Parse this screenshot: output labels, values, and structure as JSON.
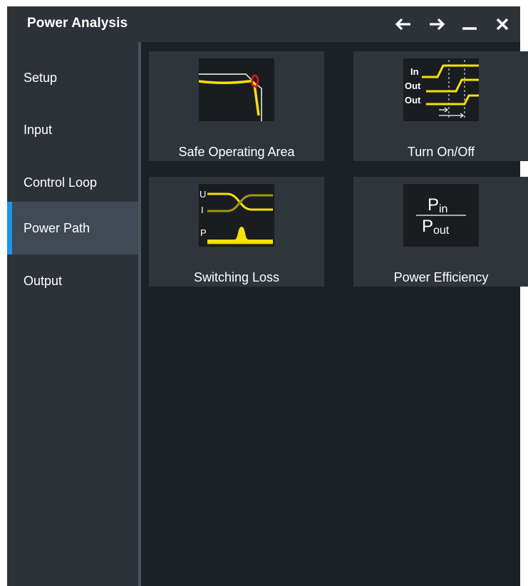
{
  "window": {
    "title": "Power Analysis",
    "controls": {
      "back_icon": "arrow-left",
      "forward_icon": "arrow-right",
      "minimize_icon": "minimize",
      "close_icon": "close"
    }
  },
  "sidebar": {
    "items": [
      {
        "label": "Setup",
        "active": false
      },
      {
        "label": "Input",
        "active": false
      },
      {
        "label": "Control Loop",
        "active": false
      },
      {
        "label": "Power Path",
        "active": true
      },
      {
        "label": "Output",
        "active": false
      }
    ]
  },
  "tiles": [
    {
      "label": "Safe Operating Area",
      "icon": "safe-operating-area-icon"
    },
    {
      "label": "Turn On/Off",
      "icon": "turn-on-off-icon",
      "icon_text": {
        "in": "In",
        "out1": "Out",
        "out2": "Out"
      }
    },
    {
      "label": "Switching Loss",
      "icon": "switching-loss-icon",
      "icon_text": {
        "u": "U",
        "i": "I",
        "p": "P"
      }
    },
    {
      "label": "Power Efficiency",
      "icon": "power-efficiency-icon",
      "icon_text": {
        "p_top": "P",
        "sub_top": "in",
        "p_bottom": "P",
        "sub_bottom": "out"
      }
    }
  ],
  "colors": {
    "accent": "#1f93ea",
    "signal_yellow": "#f5e10b",
    "window_bg": "#1c2125",
    "panel_bg": "#2c3237"
  }
}
